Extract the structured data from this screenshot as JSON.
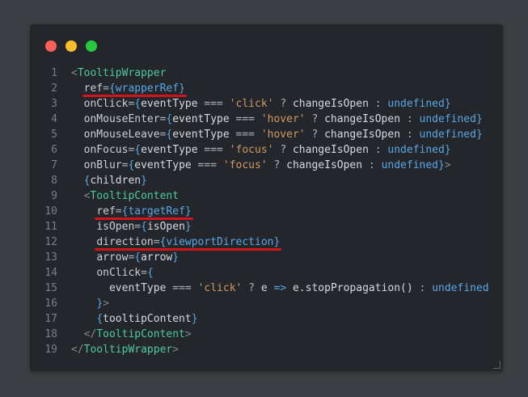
{
  "window": {
    "controls": {
      "close_color": "#fc5f57",
      "minimize_color": "#fdbd2e",
      "maximize_color": "#27c840"
    }
  },
  "code": {
    "lines": [
      {
        "n": "1",
        "tokens": [
          [
            "punct",
            "<"
          ],
          [
            "tag",
            "TooltipWrapper"
          ]
        ]
      },
      {
        "n": "2",
        "tokens": [
          [
            "punct",
            "  "
          ],
          [
            "prop",
            "ref"
          ],
          [
            "op",
            "="
          ],
          [
            "brace",
            "{"
          ],
          [
            "kw",
            "wrapperRef"
          ],
          [
            "brace",
            "}"
          ]
        ]
      },
      {
        "n": "3",
        "tokens": [
          [
            "punct",
            "  "
          ],
          [
            "prop",
            "onClick"
          ],
          [
            "op",
            "="
          ],
          [
            "brace",
            "{"
          ],
          [
            "ident",
            "eventType"
          ],
          [
            "op",
            " === "
          ],
          [
            "str",
            "'click'"
          ],
          [
            "op",
            " ? "
          ],
          [
            "ident",
            "changeIsOpen"
          ],
          [
            "op",
            " : "
          ],
          [
            "kw",
            "undefined"
          ],
          [
            "brace",
            "}"
          ]
        ]
      },
      {
        "n": "4",
        "tokens": [
          [
            "punct",
            "  "
          ],
          [
            "prop",
            "onMouseEnter"
          ],
          [
            "op",
            "="
          ],
          [
            "brace",
            "{"
          ],
          [
            "ident",
            "eventType"
          ],
          [
            "op",
            " === "
          ],
          [
            "str",
            "'hover'"
          ],
          [
            "op",
            " ? "
          ],
          [
            "ident",
            "changeIsOpen"
          ],
          [
            "op",
            " : "
          ],
          [
            "kw",
            "undefined"
          ],
          [
            "brace",
            "}"
          ]
        ]
      },
      {
        "n": "5",
        "tokens": [
          [
            "punct",
            "  "
          ],
          [
            "prop",
            "onMouseLeave"
          ],
          [
            "op",
            "="
          ],
          [
            "brace",
            "{"
          ],
          [
            "ident",
            "eventType"
          ],
          [
            "op",
            " === "
          ],
          [
            "str",
            "'hover'"
          ],
          [
            "op",
            " ? "
          ],
          [
            "ident",
            "changeIsOpen"
          ],
          [
            "op",
            " : "
          ],
          [
            "kw",
            "undefined"
          ],
          [
            "brace",
            "}"
          ]
        ]
      },
      {
        "n": "6",
        "tokens": [
          [
            "punct",
            "  "
          ],
          [
            "prop",
            "onFocus"
          ],
          [
            "op",
            "="
          ],
          [
            "brace",
            "{"
          ],
          [
            "ident",
            "eventType"
          ],
          [
            "op",
            " === "
          ],
          [
            "str",
            "'focus'"
          ],
          [
            "op",
            " ? "
          ],
          [
            "ident",
            "changeIsOpen"
          ],
          [
            "op",
            " : "
          ],
          [
            "kw",
            "undefined"
          ],
          [
            "brace",
            "}"
          ]
        ]
      },
      {
        "n": "7",
        "tokens": [
          [
            "punct",
            "  "
          ],
          [
            "prop",
            "onBlur"
          ],
          [
            "op",
            "="
          ],
          [
            "brace",
            "{"
          ],
          [
            "ident",
            "eventType"
          ],
          [
            "op",
            " === "
          ],
          [
            "str",
            "'focus'"
          ],
          [
            "op",
            " ? "
          ],
          [
            "ident",
            "changeIsOpen"
          ],
          [
            "op",
            " : "
          ],
          [
            "kw",
            "undefined"
          ],
          [
            "brace",
            "}"
          ],
          [
            "punct",
            ">"
          ]
        ]
      },
      {
        "n": "8",
        "tokens": [
          [
            "punct",
            "  "
          ],
          [
            "brace",
            "{"
          ],
          [
            "ident",
            "children"
          ],
          [
            "brace",
            "}"
          ]
        ]
      },
      {
        "n": "9",
        "tokens": [
          [
            "punct",
            "  <"
          ],
          [
            "tag",
            "TooltipContent"
          ]
        ]
      },
      {
        "n": "10",
        "tokens": [
          [
            "punct",
            "    "
          ],
          [
            "prop",
            "ref"
          ],
          [
            "op",
            "="
          ],
          [
            "brace",
            "{"
          ],
          [
            "kw",
            "targetRef"
          ],
          [
            "brace",
            "}"
          ]
        ]
      },
      {
        "n": "11",
        "tokens": [
          [
            "punct",
            "    "
          ],
          [
            "prop",
            "isOpen"
          ],
          [
            "op",
            "="
          ],
          [
            "brace",
            "{"
          ],
          [
            "ident",
            "isOpen"
          ],
          [
            "brace",
            "}"
          ]
        ]
      },
      {
        "n": "12",
        "tokens": [
          [
            "punct",
            "    "
          ],
          [
            "prop",
            "direction"
          ],
          [
            "op",
            "="
          ],
          [
            "brace",
            "{"
          ],
          [
            "kw",
            "viewportDirection"
          ],
          [
            "brace",
            "}"
          ]
        ]
      },
      {
        "n": "13",
        "tokens": [
          [
            "punct",
            "    "
          ],
          [
            "prop",
            "arrow"
          ],
          [
            "op",
            "="
          ],
          [
            "brace",
            "{"
          ],
          [
            "ident",
            "arrow"
          ],
          [
            "brace",
            "}"
          ]
        ]
      },
      {
        "n": "14",
        "tokens": [
          [
            "punct",
            "    "
          ],
          [
            "prop",
            "onClick"
          ],
          [
            "op",
            "="
          ],
          [
            "brace",
            "{"
          ]
        ]
      },
      {
        "n": "15",
        "tokens": [
          [
            "punct",
            "      "
          ],
          [
            "ident",
            "eventType"
          ],
          [
            "op",
            " === "
          ],
          [
            "str",
            "'click'"
          ],
          [
            "op",
            " ? "
          ],
          [
            "ident",
            "e"
          ],
          [
            "kw",
            " => "
          ],
          [
            "ident",
            "e.stopPropagation()"
          ],
          [
            "op",
            " : "
          ],
          [
            "kw",
            "undefined"
          ]
        ]
      },
      {
        "n": "16",
        "tokens": [
          [
            "punct",
            "    "
          ],
          [
            "brace",
            "}"
          ],
          [
            "punct",
            ">"
          ]
        ]
      },
      {
        "n": "17",
        "tokens": [
          [
            "punct",
            "    "
          ],
          [
            "brace",
            "{"
          ],
          [
            "ident",
            "tooltipContent"
          ],
          [
            "brace",
            "}"
          ]
        ]
      },
      {
        "n": "18",
        "tokens": [
          [
            "punct",
            "  </"
          ],
          [
            "tag",
            "TooltipContent"
          ],
          [
            "punct",
            ">"
          ]
        ]
      },
      {
        "n": "19",
        "tokens": [
          [
            "punct",
            "</"
          ],
          [
            "tag",
            "TooltipWrapper"
          ],
          [
            "punct",
            ">"
          ]
        ]
      }
    ],
    "underlined_lines": [
      "2",
      "10",
      "12"
    ],
    "underline_color": "#d4141a"
  }
}
